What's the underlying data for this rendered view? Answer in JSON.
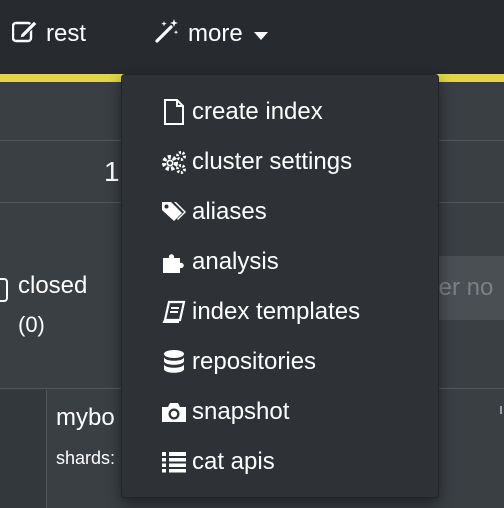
{
  "nav": {
    "rest_label": "rest",
    "more_label": "more"
  },
  "page": {
    "count": "1",
    "closed_label": "closed",
    "closed_count": "(0)",
    "filter_placeholder": "ter no",
    "index_name": "mybo",
    "shards_label": "shards:"
  },
  "menu": {
    "items": [
      {
        "label": "create index",
        "icon": "file-icon"
      },
      {
        "label": "cluster settings",
        "icon": "cogs-icon"
      },
      {
        "label": "aliases",
        "icon": "tags-icon"
      },
      {
        "label": "analysis",
        "icon": "puzzle-icon"
      },
      {
        "label": "index templates",
        "icon": "book-icon"
      },
      {
        "label": "repositories",
        "icon": "database-icon"
      },
      {
        "label": "snapshot",
        "icon": "camera-icon"
      },
      {
        "label": "cat apis",
        "icon": "list-icon"
      }
    ]
  },
  "colors": {
    "topbar": "#272b30",
    "accent": "#e2d548",
    "menu_bg": "#2e3236",
    "page_bg": "#3a3f44"
  }
}
